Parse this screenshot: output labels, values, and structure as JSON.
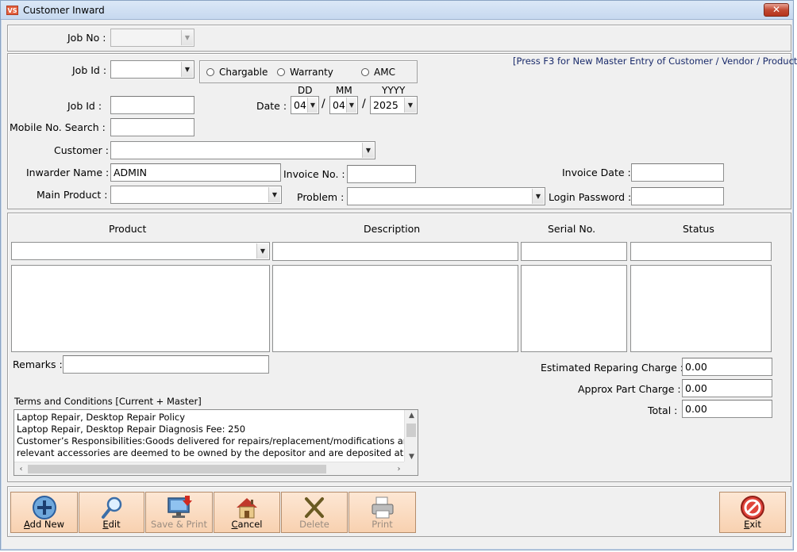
{
  "window": {
    "app_icon": "VS",
    "title": "Customer Inward",
    "close_glyph": "✕"
  },
  "header": {
    "job_no_label": "Job No :",
    "job_no_value": ""
  },
  "form": {
    "job_id_combo_label": "Job Id :",
    "job_id_combo_value": "",
    "type_options": [
      "Chargable",
      "Warranty",
      "AMC"
    ],
    "hint": "[Press F3 for New Master Entry of Customer / Vendor / Product]",
    "job_id_label": "Job Id :",
    "job_id_value": "",
    "date_label": "Date :",
    "date_headers": {
      "dd": "DD",
      "mm": "MM",
      "yyyy": "YYYY"
    },
    "date_day": "04",
    "date_month": "04",
    "date_year": "2025",
    "date_sep": "/",
    "mobile_label": "Mobile No. Search :",
    "mobile_value": "",
    "customer_label": "Customer :",
    "customer_value": "",
    "inwarder_label": "Inwarder Name :",
    "inwarder_value": "ADMIN",
    "invoice_no_label": "Invoice No. :",
    "invoice_no_value": "",
    "invoice_date_label": "Invoice Date :",
    "invoice_date_value": "",
    "main_product_label": "Main Product :",
    "main_product_value": "",
    "problem_label": "Problem :",
    "problem_value": "",
    "login_password_label": "Login Password :",
    "login_password_value": ""
  },
  "grid": {
    "columns": [
      "Product",
      "Description",
      "Serial No.",
      "Status"
    ]
  },
  "remarks": {
    "label": "Remarks :",
    "value": ""
  },
  "charges": {
    "estimated_label": "Estimated Reparing Charge :",
    "estimated_value": "0.00",
    "part_label": "Approx Part Charge :",
    "part_value": "0.00",
    "total_label": "Total :",
    "total_value": "0.00"
  },
  "terms": {
    "label": "Terms and Conditions [Current + Master]",
    "lines": [
      "Laptop Repair, Desktop Repair Policy",
      "Laptop Repair, Desktop Repair Diagnosis Fee: 250",
      "Customer’s Responsibilities:Goods delivered for repairs/replacement/modifications and a",
      "relevant accessories are deemed to be owned by the depositor and are deposited at the Cu"
    ]
  },
  "toolbar": {
    "add_new": "Add New",
    "edit": "Edit",
    "save_print": "Save & Print",
    "cancel": "Cancel",
    "delete": "Delete",
    "print": "Print",
    "exit": "Exit"
  },
  "colors": {
    "toolbar_bg": "#f8d1b0",
    "window_bg": "#f0f0f0",
    "close_red": "#c24a33"
  }
}
